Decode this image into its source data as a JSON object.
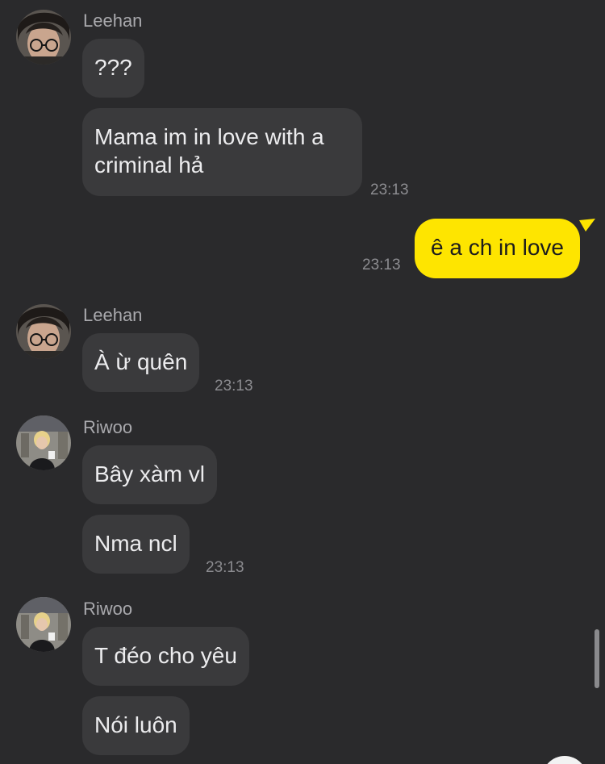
{
  "messages": [
    {
      "sender": "Leehan",
      "bubbles": [
        "???",
        "Mama im in love with a criminal hả"
      ],
      "time": "23:13"
    },
    {
      "sender": "me",
      "bubbles": [
        "ê a ch in love"
      ],
      "time": "23:13"
    },
    {
      "sender": "Leehan",
      "bubbles": [
        "À ừ quên"
      ],
      "time": "23:13"
    },
    {
      "sender": "Riwoo",
      "bubbles": [
        "Bây xàm vl",
        "Nma ncl"
      ],
      "time": "23:13"
    },
    {
      "sender": "Riwoo",
      "bubbles": [
        "T đéo cho yêu",
        "Nói luôn"
      ]
    }
  ],
  "colors": {
    "background": "#2a2a2c",
    "incoming_bubble": "#3a3a3c",
    "outgoing_bubble": "#fee500",
    "sender_text": "#a9a9ad",
    "timestamp_text": "#8c8c90"
  }
}
